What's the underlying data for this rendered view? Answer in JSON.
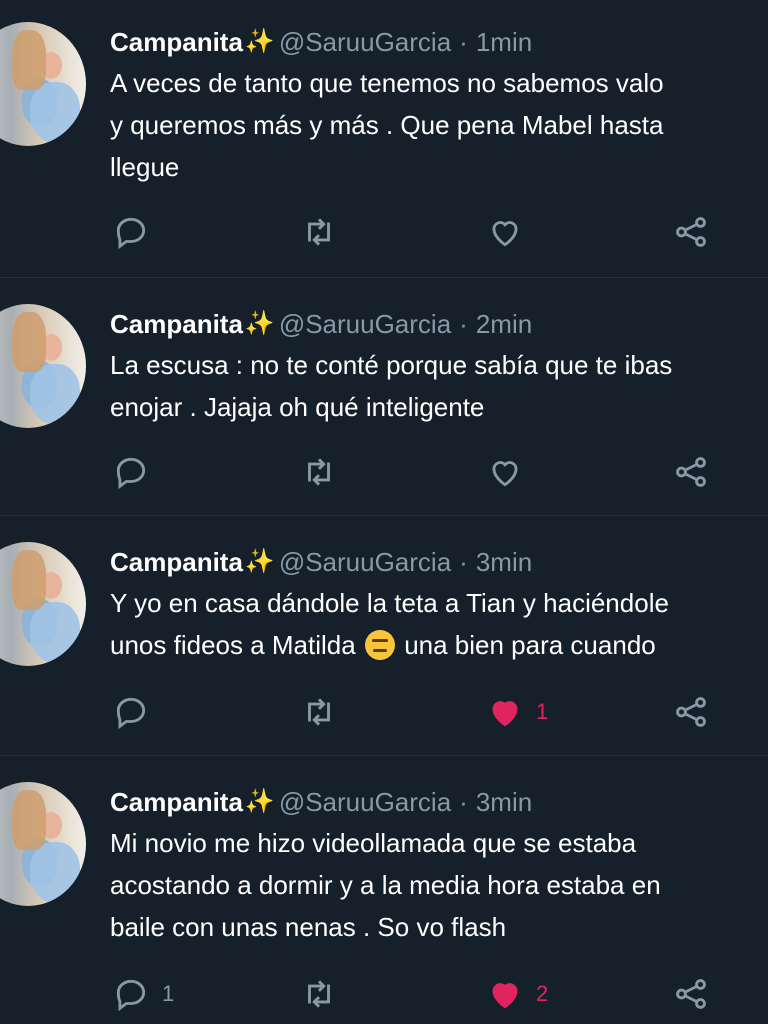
{
  "tweets": [
    {
      "name": "Campanita",
      "sparkle": "✨",
      "handle": "@SaruuGarcia",
      "dot": "·",
      "time": "1min",
      "lines": [
        "A veces de tanto que tenemos no sabemos valo",
        "y queremos más y más . Que pena Mabel hasta",
        "llegue"
      ],
      "reply_count": "",
      "retweet_count": "",
      "like_count": "",
      "liked": false
    },
    {
      "name": "Campanita",
      "sparkle": "✨",
      "handle": "@SaruuGarcia",
      "dot": "·",
      "time": "2min",
      "lines": [
        "La escusa : no te conté porque sabía que te ibas",
        "enojar . Jajaja oh qué inteligente"
      ],
      "reply_count": "",
      "retweet_count": "",
      "like_count": "",
      "liked": false
    },
    {
      "name": "Campanita",
      "sparkle": "✨",
      "handle": "@SaruuGarcia",
      "dot": "·",
      "time": "3min",
      "lines": [
        "Y yo en casa dándole la teta a Tian y haciéndole",
        "unos fideos a Matilda",
        "una bien para cuando"
      ],
      "emoji": "expressionless-face-emoji",
      "reply_count": "",
      "retweet_count": "",
      "like_count": "1",
      "liked": true
    },
    {
      "name": "Campanita",
      "sparkle": "✨",
      "handle": "@SaruuGarcia",
      "dot": "·",
      "time": "3min",
      "lines": [
        "Mi novio me hizo videollamada que se estaba",
        "acostando a dormir y a la media hora estaba en",
        "baile con unas nenas . So vo flash"
      ],
      "reply_count": "1",
      "retweet_count": "",
      "like_count": "2",
      "liked": true
    }
  ],
  "icons": {
    "reply": "reply-icon",
    "retweet": "retweet-icon",
    "like": "heart-icon",
    "share": "share-icon"
  },
  "colors": {
    "background": "#15202b",
    "muted": "#8899a6",
    "like": "#e0245e",
    "sparkle": "#f5c518"
  }
}
